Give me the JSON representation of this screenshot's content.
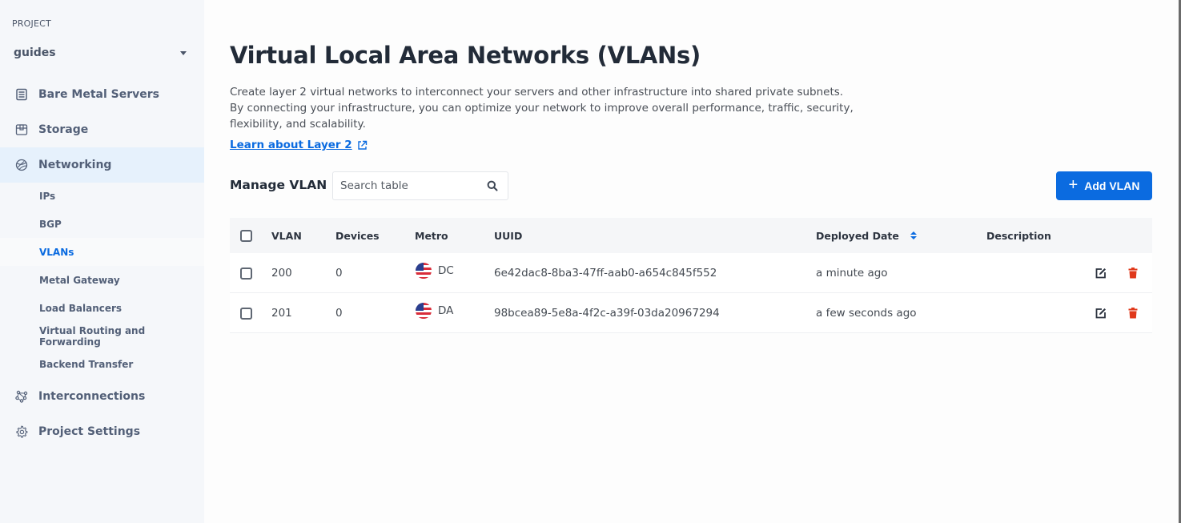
{
  "sidebar": {
    "project_label": "PROJECT",
    "project_name": "guides",
    "nav": [
      {
        "label": "Bare Metal Servers",
        "icon": "server-list-icon"
      },
      {
        "label": "Storage",
        "icon": "storage-box-icon"
      },
      {
        "label": "Networking",
        "icon": "globe-network-icon",
        "active": true
      },
      {
        "label": "Interconnections",
        "icon": "interconnect-nodes-icon"
      },
      {
        "label": "Project Settings",
        "icon": "gear-icon"
      }
    ],
    "sub_nav": [
      {
        "label": "IPs"
      },
      {
        "label": "BGP"
      },
      {
        "label": "VLANs",
        "active": true
      },
      {
        "label": "Metal Gateway"
      },
      {
        "label": "Load Balancers"
      },
      {
        "label": "Virtual Routing and Forwarding"
      },
      {
        "label": "Backend Transfer"
      }
    ]
  },
  "page": {
    "title": "Virtual Local Area Networks (VLANs)",
    "description": "Create layer 2 virtual networks to interconnect your servers and other infrastructure into shared private subnets. By connecting your infrastructure, you can optimize your network to improve overall performance, traffic, security, flexibility, and scalability.",
    "learn_link": "Learn about Layer 2",
    "section_title": "Manage VLAN",
    "search_placeholder": "Search table",
    "add_button": "Add VLAN",
    "accent_color": "#0b6be0",
    "delete_color": "#e0391b"
  },
  "table": {
    "columns": [
      "VLAN",
      "Devices",
      "Metro",
      "UUID",
      "Deployed Date",
      "Description"
    ],
    "sorted_column": "Deployed Date",
    "rows": [
      {
        "vlan": "200",
        "devices": "0",
        "metro": "DC",
        "flag": "us",
        "uuid": "6e42dac8-8ba3-47ff-aab0-a654c845f552",
        "deployed": "a minute ago",
        "description": ""
      },
      {
        "vlan": "201",
        "devices": "0",
        "metro": "DA",
        "flag": "us",
        "uuid": "98bcea89-5e8a-4f2c-a39f-03da20967294",
        "deployed": "a few seconds ago",
        "description": ""
      }
    ]
  }
}
